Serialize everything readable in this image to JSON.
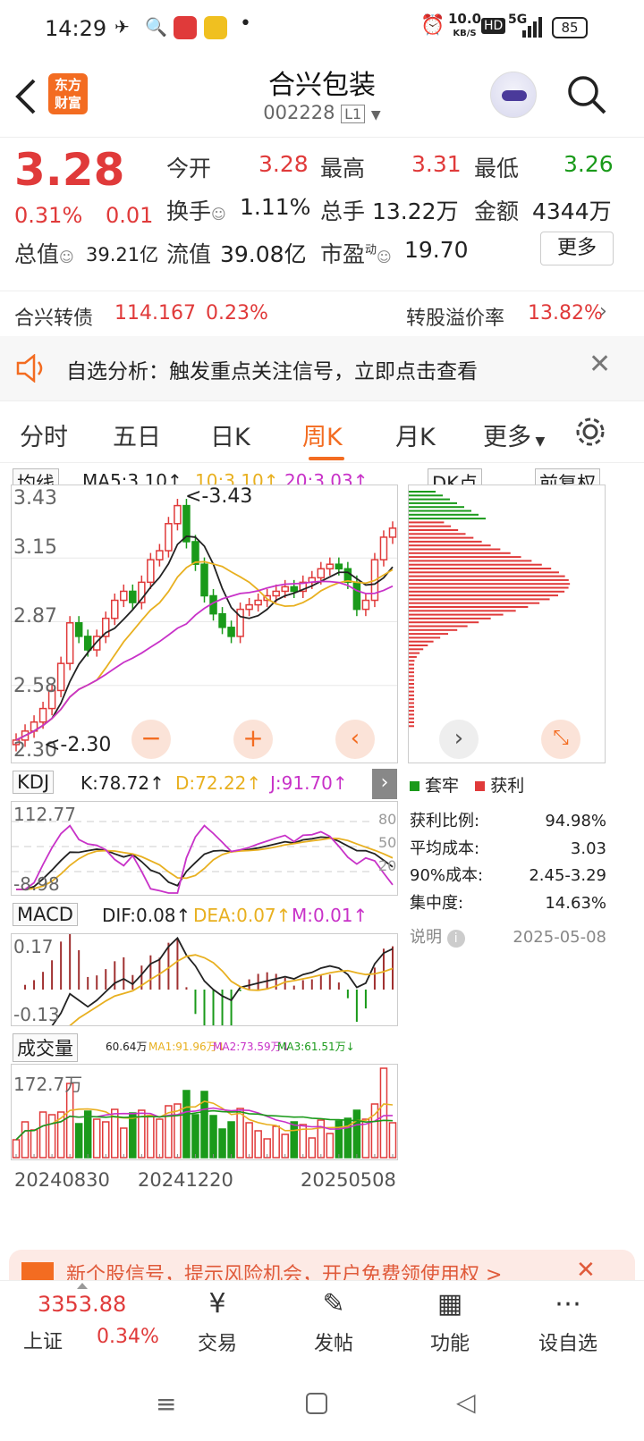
{
  "status": {
    "time": "14:29",
    "speed": "10.0",
    "speed_unit": "KB/S",
    "hd": "HD",
    "net": "5G",
    "battery": "85"
  },
  "header": {
    "title": "合兴包装",
    "code": "002228",
    "level": "L1",
    "brand_line1": "东方",
    "brand_line2": "财富"
  },
  "quote": {
    "price": "3.28",
    "pct": "0.31%",
    "chg": "0.01",
    "open_label": "今开",
    "open": "3.28",
    "high_label": "最高",
    "high": "3.31",
    "low_label": "最低",
    "low": "3.26",
    "turnover_label": "换手",
    "turnover": "1.11%",
    "vol_label": "总手",
    "vol": "13.22万",
    "amt_label": "金额",
    "amt": "4344万",
    "mcap_label": "总值",
    "mcap": "39.21亿",
    "float_label": "流值",
    "float": "39.08亿",
    "pe_label": "市盈",
    "pe_sup": "动",
    "pe": "19.70",
    "more": "更多"
  },
  "bond": {
    "name": "合兴转债",
    "price": "114.167",
    "pct": "0.23%",
    "prem_label": "转股溢价率",
    "prem": "13.82%"
  },
  "notice": {
    "text": "自选分析：触发重点关注信号，立即点击查看"
  },
  "tabs": [
    "分时",
    "五日",
    "日K",
    "周K",
    "月K",
    "更多"
  ],
  "tabs_active": 3,
  "ma": {
    "selector": "均线",
    "ma5": "MA5:3.10",
    "ma10": "10:3.10",
    "ma20": "20:3.03",
    "dk": "DK点",
    "adj": "前复权"
  },
  "price_axis": {
    "y1": "3.43",
    "y2": "3.15",
    "y3": "2.87",
    "y4": "2.58",
    "y5": "2.30",
    "hi_mark": "<-3.43",
    "lo_mark": "<-2.30"
  },
  "kdj": {
    "selector": "KDJ",
    "k": "K:78.72",
    "d": "D:72.22",
    "j": "J:91.70",
    "top": "112.77",
    "bottom": "-8.98",
    "l80": "80",
    "l50": "50",
    "l20": "20"
  },
  "macd": {
    "selector": "MACD",
    "dif": "DIF:0.08",
    "dea": "DEA:0.07",
    "m": "M:0.01",
    "top": "0.17",
    "bottom": "-0.13"
  },
  "vol": {
    "selector": "成交量",
    "v": "60.64万",
    "ma1": "MA1:91.96万",
    "ma2": "MA2:73.59万",
    "ma3": "MA3:61.51万",
    "top": "172.7万"
  },
  "dates": [
    "20240830",
    "20241220",
    "20250508"
  ],
  "chips": {
    "legend_trap": "套牢",
    "legend_profit": "获利",
    "profit_ratio_label": "获利比例:",
    "profit_ratio": "94.98%",
    "avg_cost_label": "平均成本:",
    "avg_cost": "3.03",
    "cost90_label": "90%成本:",
    "cost90": "2.45-3.29",
    "conc_label": "集中度:",
    "conc": "14.63%",
    "note_label": "说明",
    "date": "2025-05-08"
  },
  "promo": {
    "text": "新个股信号，提示风险机会，开户免费领使用权 >"
  },
  "bottom": {
    "index_val": "3353.88",
    "index_name": "上证",
    "index_pct": "0.34%",
    "trade": "交易",
    "post": "发帖",
    "func": "功能",
    "fav": "设自选"
  },
  "colors": {
    "up": "#e03a3a",
    "down": "#1a9a1a",
    "accent": "#f36c21",
    "ma5": "#222222",
    "ma10": "#e8b020",
    "ma20": "#c832c8"
  },
  "chart_data": {
    "type": "candlestick",
    "period": "weekly",
    "note_dates": [
      "20240830",
      "20241220",
      "20250508"
    ],
    "closes": [
      2.34,
      2.38,
      2.42,
      2.48,
      2.56,
      2.68,
      2.86,
      2.8,
      2.74,
      2.8,
      2.88,
      2.96,
      3.0,
      2.95,
      3.04,
      3.14,
      3.18,
      3.3,
      3.38,
      3.22,
      3.12,
      2.98,
      2.9,
      2.84,
      2.8,
      2.92,
      2.94,
      2.96,
      2.98,
      3.0,
      3.02,
      3.0,
      3.04,
      3.06,
      3.1,
      3.12,
      3.1,
      3.04,
      2.92,
      2.96,
      3.14,
      3.24,
      3.28
    ],
    "ylim": [
      2.3,
      3.43
    ]
  }
}
